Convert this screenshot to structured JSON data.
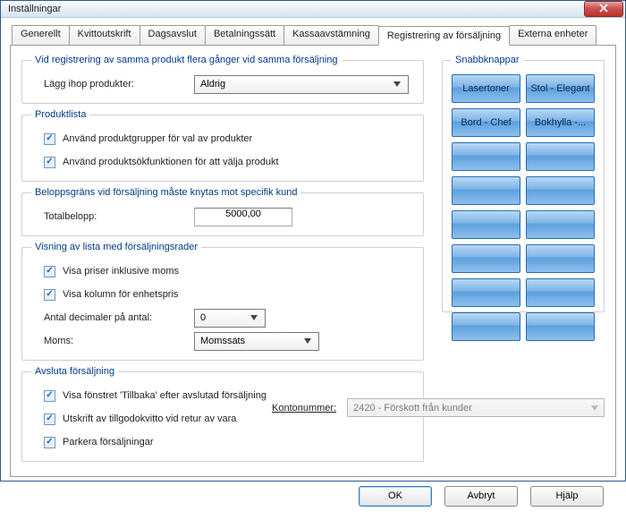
{
  "window": {
    "title": "Inställningar"
  },
  "tabs": [
    "Generellt",
    "Kvittoutskrift",
    "Dagsavslut",
    "Betalningssätt",
    "Kassaavstämning",
    "Registrering av försäljning",
    "Externa enheter"
  ],
  "activeTab": 5,
  "registration": {
    "sameProduct": {
      "legend": "Vid registrering av samma produkt flera gånger vid samma försäljning",
      "combineLabel": "Lägg ihop produkter:",
      "combineValue": "Aldrig"
    },
    "productList": {
      "legend": "Produktlista",
      "useGroups": "Använd produktgrupper för val av produkter",
      "useSearch": "Använd produktsökfunktionen för att välja produkt"
    },
    "amountLimit": {
      "legend": "Beloppsgräns vid försäljning måste knytas mot specifik kund",
      "totalLabel": "Totalbelopp:",
      "totalValue": "5000,00"
    },
    "listView": {
      "legend": "Visning av lista med försäljningsrader",
      "inclVat": "Visa priser inklusive moms",
      "unitPrice": "Visa kolumn för enhetspris",
      "decimalsLabel": "Antal decimaler på antal:",
      "decimalsValue": "0",
      "vatLabel": "Moms:",
      "vatValue": "Momssats"
    },
    "finishSale": {
      "legend": "Avsluta försäljning",
      "showBack": "Visa fönstret 'Tillbaka' efter avslutad försäljning",
      "printCredit": "Utskrift av tillgodokvitto vid retur av vara",
      "park": "Parkera försäljningar",
      "accountLabel": "Kontonummer:",
      "accountValue": "2420 - Förskott från kunder"
    }
  },
  "quick": {
    "legend": "Snabbknappar",
    "buttons": [
      "Lasertoner",
      "Stol - Elegant",
      "Bord - Chef",
      "Bokhylla -...",
      "",
      "",
      "",
      "",
      "",
      "",
      "",
      "",
      "",
      "",
      "",
      ""
    ]
  },
  "footer": {
    "ok": "OK",
    "cancel": "Avbryt",
    "help": "Hjälp"
  }
}
